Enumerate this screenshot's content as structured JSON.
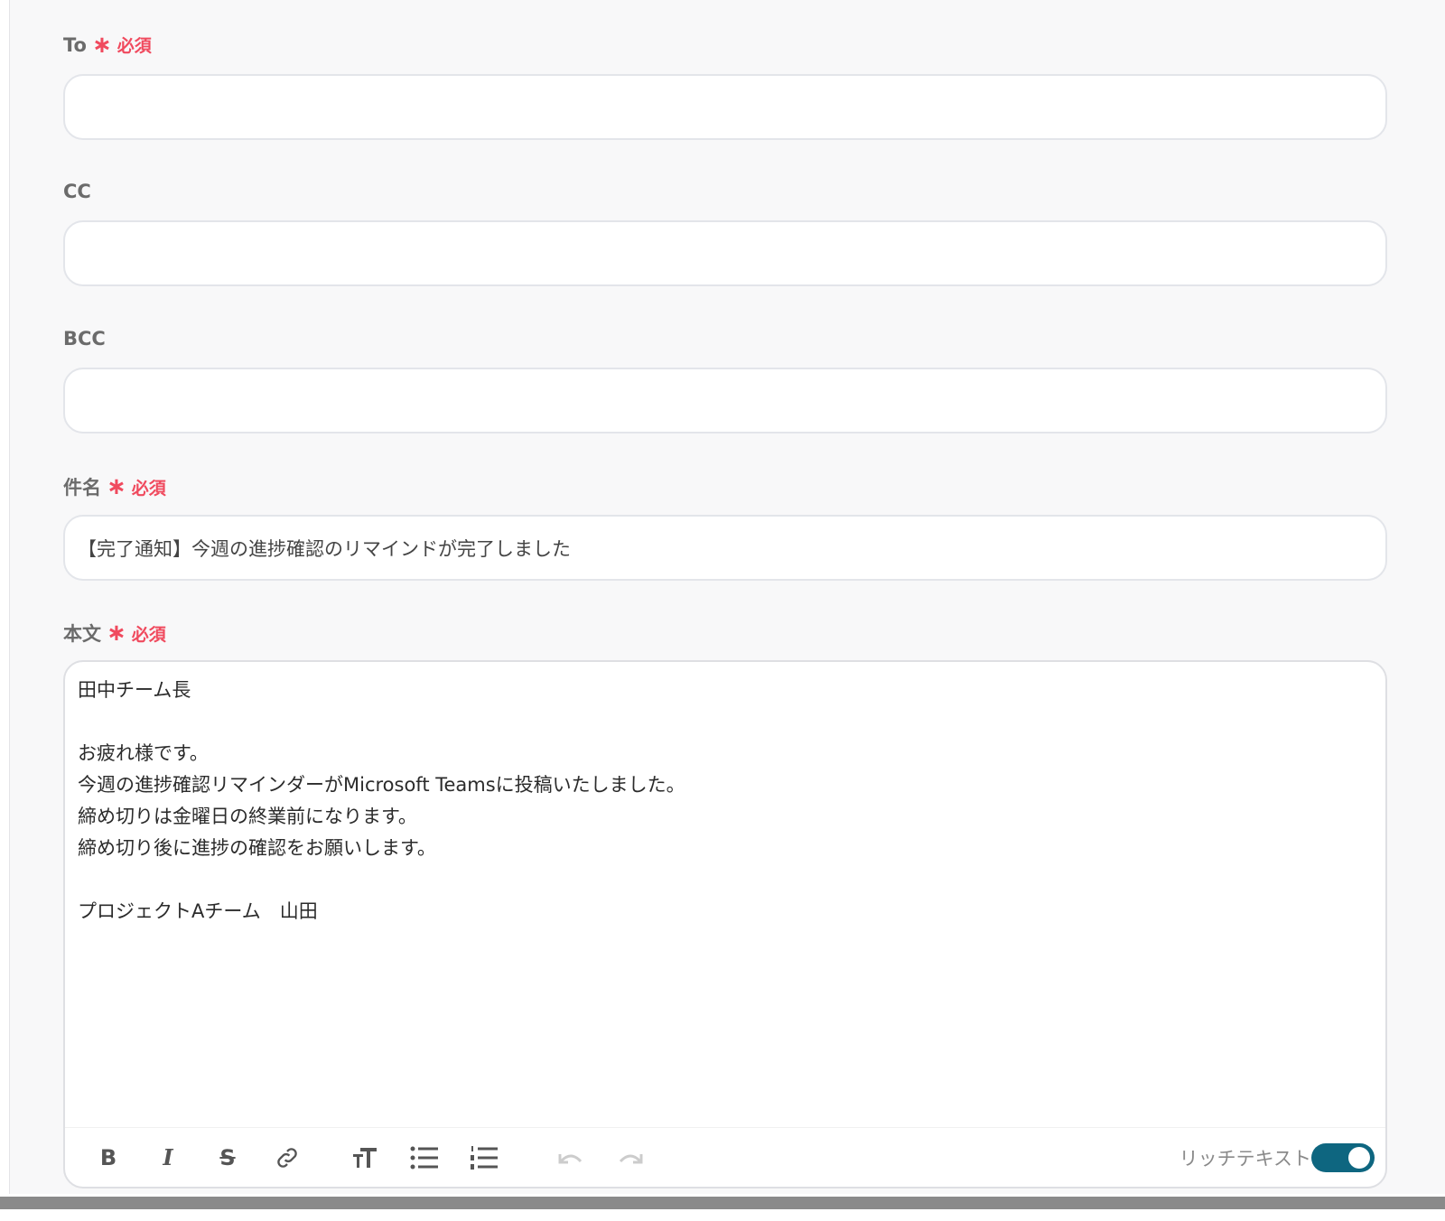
{
  "fields": {
    "to": {
      "label": "To",
      "required": "必須",
      "value": ""
    },
    "cc": {
      "label": "CC",
      "value": ""
    },
    "bcc": {
      "label": "BCC",
      "value": ""
    },
    "subject": {
      "label": "件名",
      "required": "必須",
      "value": "【完了通知】今週の進捗確認のリマインドが完了しました"
    },
    "body": {
      "label": "本文",
      "required": "必須",
      "value": "田中チーム長\n\nお疲れ様です。\n今週の進捗確認リマインダーがMicrosoft Teamsに投稿いたしました。\n締め切りは金曜日の終業前になります。\n締め切り後に進捗の確認をお願いします。\n\nプロジェクトAチーム　山田"
    }
  },
  "asterisk": "∗",
  "toolbar": {
    "bold": "B",
    "italic": "I",
    "strike": "S",
    "rich_text_label": "リッチテキスト",
    "rich_text_on": true
  },
  "colors": {
    "required": "#f04a5e",
    "toggle": "#0e6680"
  }
}
